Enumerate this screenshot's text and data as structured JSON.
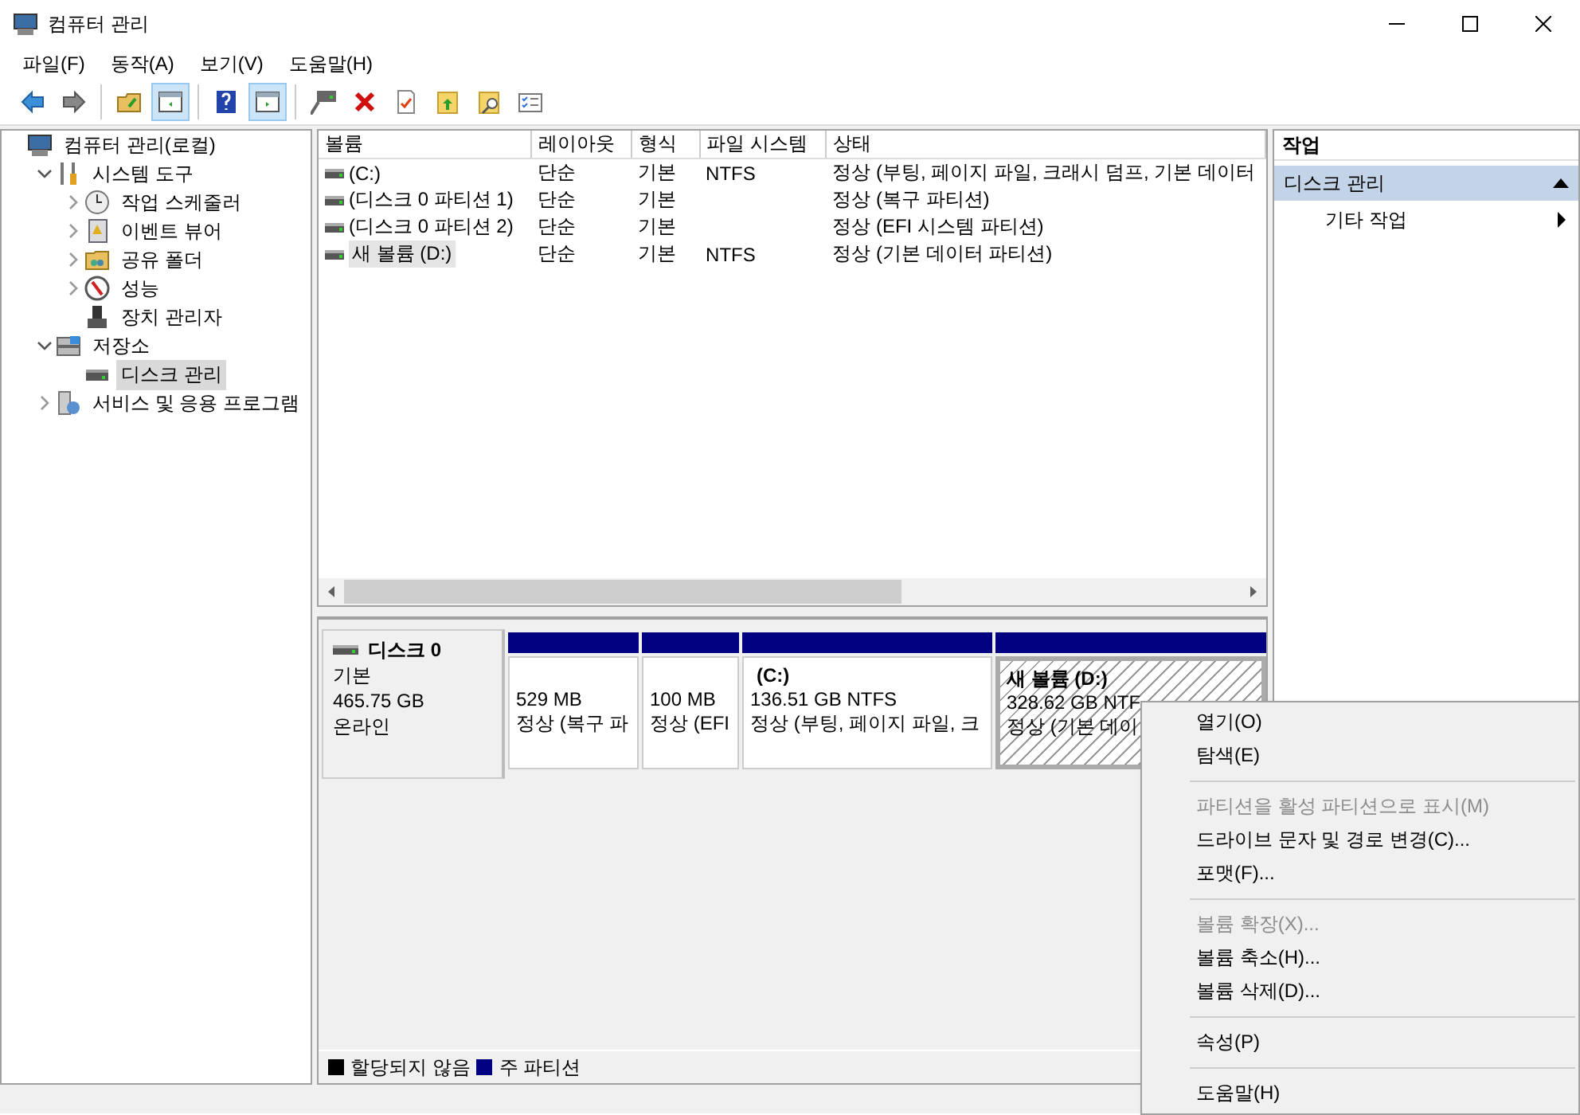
{
  "window": {
    "title": "컴퓨터 관리"
  },
  "menu": [
    "파일(F)",
    "동작(A)",
    "보기(V)",
    "도움말(H)"
  ],
  "toolbar": [
    {
      "kind": "back"
    },
    {
      "kind": "forward"
    },
    {
      "kind": "separator"
    },
    {
      "kind": "up"
    },
    {
      "kind": "tree",
      "pressed": true
    },
    {
      "kind": "separator"
    },
    {
      "kind": "help"
    },
    {
      "kind": "pane",
      "pressed": true
    },
    {
      "kind": "separator"
    },
    {
      "kind": "connect"
    },
    {
      "kind": "delete"
    },
    {
      "kind": "properties"
    },
    {
      "kind": "import"
    },
    {
      "kind": "find"
    },
    {
      "kind": "list"
    }
  ],
  "tree": [
    {
      "label": "컴퓨터 관리(로컬)",
      "kind": "computer",
      "selected": false,
      "children": [
        {
          "label": "시스템 도구",
          "kind": "tools",
          "expanded": true,
          "selected": false,
          "children": [
            {
              "label": "작업 스케줄러",
              "kind": "clock",
              "expanded": false,
              "selected": false
            },
            {
              "label": "이벤트 뷰어",
              "kind": "event",
              "expanded": false,
              "selected": false
            },
            {
              "label": "공유 폴더",
              "kind": "share",
              "expanded": false,
              "selected": false
            },
            {
              "label": "성능",
              "kind": "perf",
              "expanded": false,
              "selected": false
            },
            {
              "label": "장치 관리자",
              "kind": "device",
              "selected": false
            }
          ]
        },
        {
          "label": "저장소",
          "kind": "storage",
          "expanded": true,
          "selected": false,
          "children": [
            {
              "label": "디스크 관리",
              "kind": "disk",
              "selected": true
            }
          ]
        },
        {
          "label": "서비스 및 응용 프로그램",
          "kind": "services",
          "expanded": false,
          "selected": false
        }
      ]
    }
  ],
  "volumes": {
    "columns": [
      "볼륨",
      "레이아웃",
      "형식",
      "파일 시스템",
      "상태"
    ],
    "rows": [
      {
        "cells": [
          "(C:)",
          "단순",
          "기본",
          "NTFS",
          "정상 (부팅, 페이지 파일, 크래시 덤프, 기본 데이터"
        ],
        "selected": false
      },
      {
        "cells": [
          "(디스크 0 파티션 1)",
          "단순",
          "기본",
          "",
          "정상 (복구 파티션)"
        ],
        "selected": false
      },
      {
        "cells": [
          "(디스크 0 파티션 2)",
          "단순",
          "기본",
          "",
          "정상 (EFI 시스템 파티션)"
        ],
        "selected": false
      },
      {
        "cells": [
          "새 볼륨 (D:)",
          "단순",
          "기본",
          "NTFS",
          "정상 (기본 데이터 파티션)"
        ],
        "selected": true
      }
    ]
  },
  "disk": {
    "name": "디스크 0",
    "type": "기본",
    "size": "465.75 GB",
    "status": "온라인",
    "partitions": [
      {
        "size": "529 MB",
        "status": "정상 (복구 파",
        "selected": false
      },
      {
        "size": "100 MB",
        "status": "정상 (EFI",
        "selected": false
      },
      {
        "title": "(C:)",
        "size": "136.51 GB NTFS",
        "status": "정상 (부팅, 페이지 파일, 크",
        "selected": false
      },
      {
        "title": "새 볼륨  (D:)",
        "size": "328.62 GB NTF",
        "status": "정상 (기본 데이",
        "selected": true
      }
    ]
  },
  "legend": [
    {
      "label": "할당되지 않음",
      "color": "#000000"
    },
    {
      "label": "주 파티션",
      "color": "#000080"
    }
  ],
  "actions": {
    "title": "작업",
    "section": {
      "label": "디스크 관리",
      "expanded": true
    },
    "items": [
      {
        "label": "기타 작업"
      }
    ]
  },
  "context_menu": [
    {
      "kind": "item",
      "label": "열기(O)",
      "disabled": false
    },
    {
      "kind": "item",
      "label": "탐색(E)",
      "disabled": false
    },
    {
      "kind": "separator"
    },
    {
      "kind": "item",
      "label": "파티션을 활성 파티션으로 표시(M)",
      "disabled": true
    },
    {
      "kind": "item",
      "label": "드라이브 문자 및 경로 변경(C)...",
      "disabled": false
    },
    {
      "kind": "item",
      "label": "포맷(F)...",
      "disabled": false
    },
    {
      "kind": "separator"
    },
    {
      "kind": "item",
      "label": "볼륨 확장(X)...",
      "disabled": true
    },
    {
      "kind": "item",
      "label": "볼륨 축소(H)...",
      "disabled": false
    },
    {
      "kind": "item",
      "label": "볼륨 삭제(D)...",
      "disabled": false
    },
    {
      "kind": "separator"
    },
    {
      "kind": "item",
      "label": "속성(P)",
      "disabled": false
    },
    {
      "kind": "separator"
    },
    {
      "kind": "item",
      "label": "도움말(H)",
      "disabled": false
    }
  ]
}
